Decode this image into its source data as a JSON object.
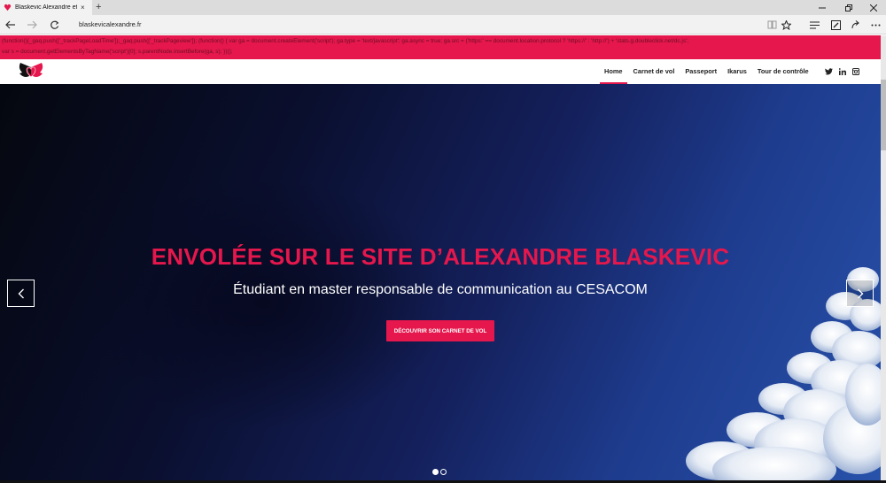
{
  "browser": {
    "tab_title": "Blaskevic Alexandre etu",
    "tab_close": "×",
    "new_tab": "+",
    "url": "blaskevicalexandre.fr"
  },
  "error_lines": [
    "(function(){_gaq.push(['_trackPageLoadTime']);_gaq.push(['_trackPageview']); (function() { var ga = document.createElement('script'); ga.type = 'text/javascript'; ga.async = true; ga.src = ('https:' == document.location.protocol ? 'https://' : 'http://') + 'stats.g.doubleclick.net/dc.js';",
    "var s = document.getElementsByTagName('script')[0]; s.parentNode.insertBefore(ga, s); })();"
  ],
  "nav": {
    "items": [
      {
        "label": "Home",
        "active": true
      },
      {
        "label": "Carnet de vol",
        "active": false
      },
      {
        "label": "Passeport",
        "active": false
      },
      {
        "label": "Ikarus",
        "active": false
      },
      {
        "label": "Tour de contrôle",
        "active": false
      }
    ],
    "social": [
      "twitter-icon",
      "linkedin-icon",
      "instagram-icon"
    ]
  },
  "hero": {
    "title": "ENVOLÉE SUR LE SITE D’ALEXANDRE BLASKEVIC",
    "subtitle": "Étudiant en master responsable de communication au CESACOM",
    "cta": "DÉCOUVRIR SON CARNET DE VOL",
    "slides": 2,
    "active_slide": 1
  },
  "colors": {
    "accent": "#e5174c",
    "sky_dark": "#05070f",
    "sky_light": "#2852aa"
  }
}
